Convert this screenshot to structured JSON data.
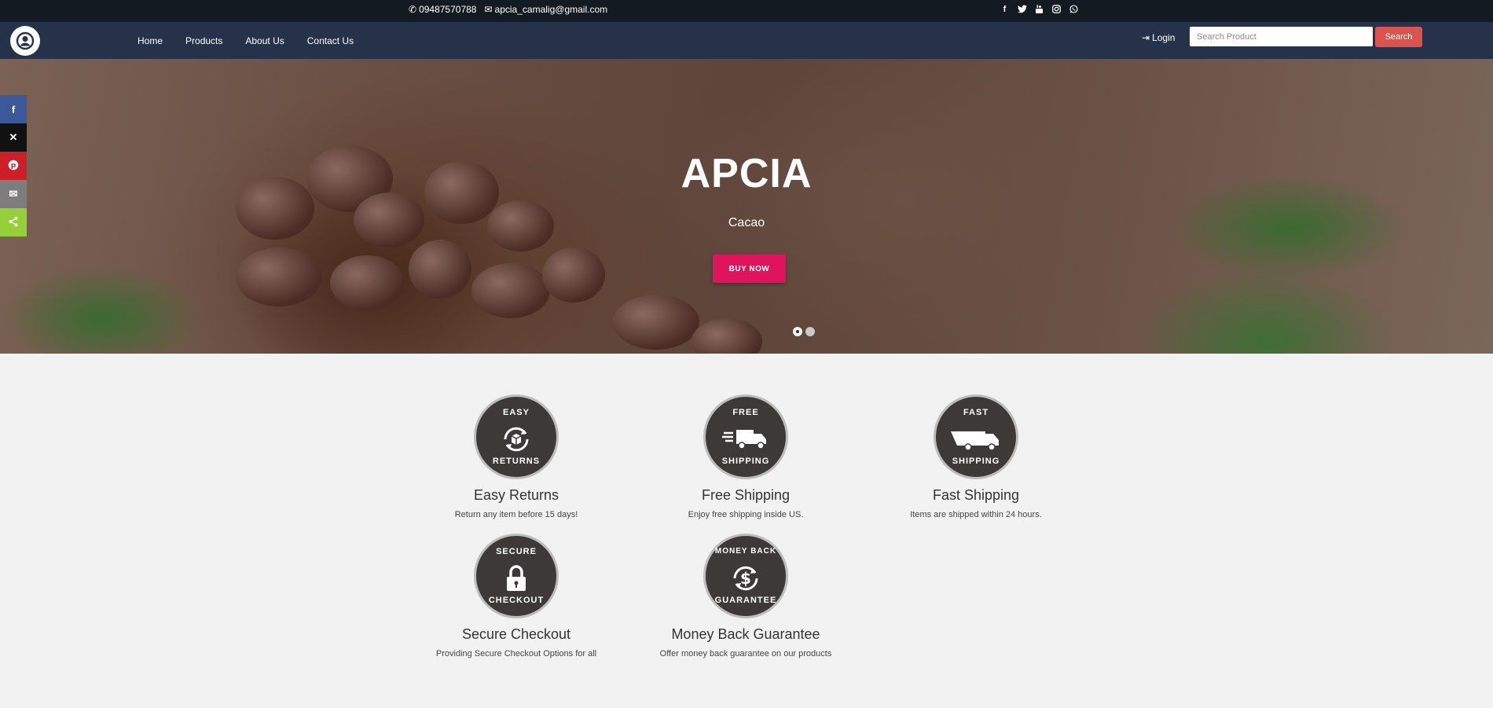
{
  "topbar": {
    "phone": "09487570788",
    "email": "apcia_camalig@gmail.com",
    "social": [
      "facebook-icon",
      "twitter-icon",
      "youtube-icon",
      "instagram-icon",
      "whatsapp-icon"
    ]
  },
  "nav": {
    "links": [
      "Home",
      "Products",
      "About Us",
      "Contact Us"
    ],
    "login": "Login",
    "search_placeholder": "Search Product",
    "search_label": "Search"
  },
  "hero": {
    "title": "APCIA",
    "subtitle": "Cacao",
    "button": "BUY NOW",
    "slides": 2,
    "active_slide": 1
  },
  "share": [
    {
      "icon": "facebook-icon",
      "glyph": "f",
      "color": "#3b5998"
    },
    {
      "icon": "x-icon",
      "glyph": "𝕏",
      "color": "#111111"
    },
    {
      "icon": "pinterest-icon",
      "glyph": "P",
      "color": "#cb2027"
    },
    {
      "icon": "email-icon",
      "glyph": "✉",
      "color": "#7d7d7d"
    },
    {
      "icon": "share-icon",
      "glyph": "<",
      "color": "#95d03a"
    }
  ],
  "features": [
    {
      "badge_top": "EASY",
      "badge_bottom": "RETURNS",
      "title": "Easy Returns",
      "text": "Return any item before 15 days!"
    },
    {
      "badge_top": "FREE",
      "badge_bottom": "SHIPPING",
      "title": "Free Shipping",
      "text": "Enjoy free shipping inside US."
    },
    {
      "badge_top": "FAST",
      "badge_bottom": "SHIPPING",
      "title": "Fast Shipping",
      "text": "Items are shipped within 24 hours."
    },
    {
      "badge_top": "SECURE",
      "badge_bottom": "CHECKOUT",
      "title": "Secure Checkout",
      "text": "Providing Secure Checkout Options for all"
    },
    {
      "badge_top": "MONEY BACK",
      "badge_bottom": "GUARANTEE",
      "title": "Money Back Guarantee",
      "text": "Offer money back guarantee on our products"
    }
  ]
}
